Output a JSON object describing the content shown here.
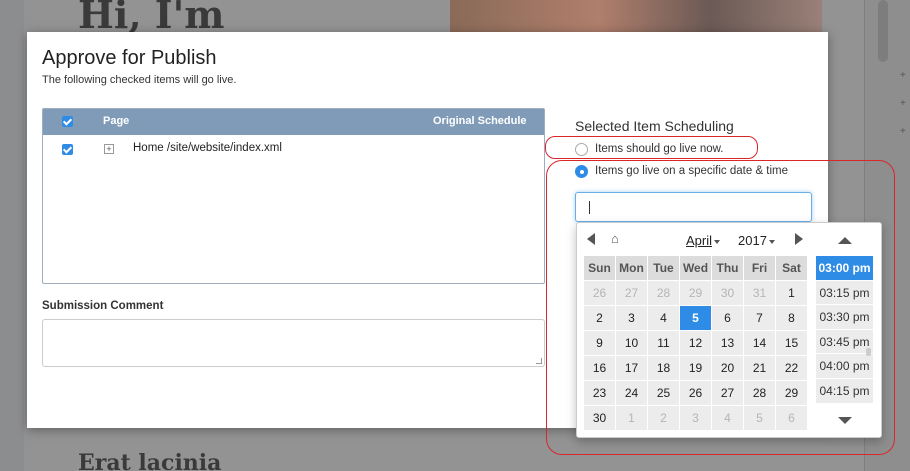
{
  "background": {
    "heading": "Hi, I'm",
    "heading2": "Erat lacinia"
  },
  "dialog": {
    "title": "Approve for Publish",
    "subtitle": "The following checked items will go live.",
    "table": {
      "col_page": "Page",
      "col_schedule": "Original Schedule",
      "rows": [
        {
          "label": "Home /site/website/index.xml",
          "checked": true
        }
      ]
    },
    "comment": {
      "label": "Submission Comment",
      "value": ""
    },
    "scheduling": {
      "title": "Selected Item Scheduling",
      "option_now": "Items should go live now.",
      "option_specific": "Items go live on a specific date & time",
      "selected": "specific",
      "date_value": ""
    },
    "picker": {
      "month": "April",
      "year": "2017",
      "weekdays": [
        "Sun",
        "Mon",
        "Tue",
        "Wed",
        "Thu",
        "Fri",
        "Sat"
      ],
      "weeks": [
        [
          "26",
          "27",
          "28",
          "29",
          "30",
          "31",
          "1"
        ],
        [
          "2",
          "3",
          "4",
          "5",
          "6",
          "7",
          "8"
        ],
        [
          "9",
          "10",
          "11",
          "12",
          "13",
          "14",
          "15"
        ],
        [
          "16",
          "17",
          "18",
          "19",
          "20",
          "21",
          "22"
        ],
        [
          "23",
          "24",
          "25",
          "26",
          "27",
          "28",
          "29"
        ],
        [
          "30",
          "1",
          "2",
          "3",
          "4",
          "5",
          "6"
        ]
      ],
      "selected_day": "5",
      "times": [
        "03:00 pm",
        "03:15 pm",
        "03:30 pm",
        "03:45 pm",
        "04:00 pm",
        "04:15 pm"
      ],
      "selected_time": "03:00 pm"
    }
  },
  "colors": {
    "accent": "#2f8ce6",
    "header": "#7f9bb8",
    "annotation": "#d9262b"
  }
}
